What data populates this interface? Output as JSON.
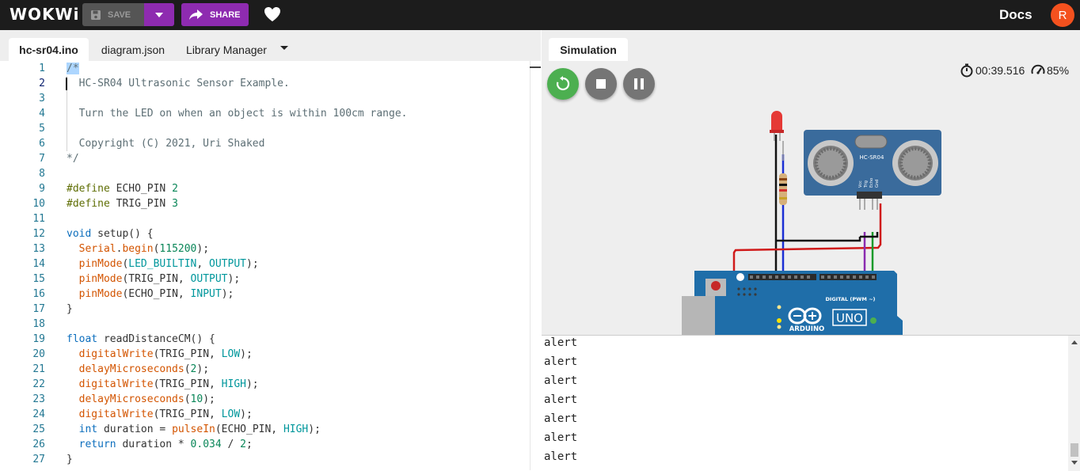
{
  "topbar": {
    "logo": "WOKWi",
    "save_label": "SAVE",
    "share_label": "SHARE",
    "docs_label": "Docs",
    "avatar_initial": "R",
    "accent": "#8e2bb0"
  },
  "editor": {
    "tabs": [
      {
        "label": "hc-sr04.ino",
        "active": true
      },
      {
        "label": "diagram.json",
        "active": false
      },
      {
        "label": "Library Manager",
        "active": false
      }
    ]
  },
  "code_lines": [
    {
      "n": "1",
      "segs": [
        {
          "t": "/*",
          "c": "c-com sel"
        }
      ]
    },
    {
      "n": "2",
      "segs": [
        {
          "t": "  HC-SR04 Ultrasonic Sensor Example.",
          "c": "c-com"
        }
      ]
    },
    {
      "n": "3",
      "segs": [
        {
          "t": "",
          "c": ""
        }
      ]
    },
    {
      "n": "4",
      "segs": [
        {
          "t": "  Turn the LED on when an object is within 100cm range.",
          "c": "c-com"
        }
      ]
    },
    {
      "n": "5",
      "segs": [
        {
          "t": "",
          "c": ""
        }
      ]
    },
    {
      "n": "6",
      "segs": [
        {
          "t": "  Copyright (C) 2021, Uri Shaked",
          "c": "c-com"
        }
      ]
    },
    {
      "n": "7",
      "segs": [
        {
          "t": "*/",
          "c": "c-com"
        }
      ]
    },
    {
      "n": "8",
      "segs": [
        {
          "t": "",
          "c": ""
        }
      ]
    },
    {
      "n": "9",
      "segs": [
        {
          "t": "#define",
          "c": "c-def"
        },
        {
          "t": " ECHO_PIN ",
          "c": ""
        },
        {
          "t": "2",
          "c": "c-num"
        }
      ]
    },
    {
      "n": "10",
      "segs": [
        {
          "t": "#define",
          "c": "c-def"
        },
        {
          "t": " TRIG_PIN ",
          "c": ""
        },
        {
          "t": "3",
          "c": "c-num"
        }
      ]
    },
    {
      "n": "11",
      "segs": [
        {
          "t": "",
          "c": ""
        }
      ]
    },
    {
      "n": "12",
      "segs": [
        {
          "t": "void",
          "c": "c-kw"
        },
        {
          "t": " setup() {",
          "c": ""
        }
      ]
    },
    {
      "n": "13",
      "segs": [
        {
          "t": "  ",
          "c": ""
        },
        {
          "t": "Serial",
          "c": "c-fn"
        },
        {
          "t": ".",
          "c": ""
        },
        {
          "t": "begin",
          "c": "c-fn"
        },
        {
          "t": "(",
          "c": ""
        },
        {
          "t": "115200",
          "c": "c-num"
        },
        {
          "t": ");",
          "c": ""
        }
      ]
    },
    {
      "n": "14",
      "segs": [
        {
          "t": "  ",
          "c": ""
        },
        {
          "t": "pinMode",
          "c": "c-fn"
        },
        {
          "t": "(",
          "c": ""
        },
        {
          "t": "LED_BUILTIN",
          "c": "c-cn"
        },
        {
          "t": ", ",
          "c": ""
        },
        {
          "t": "OUTPUT",
          "c": "c-cn"
        },
        {
          "t": ");",
          "c": ""
        }
      ]
    },
    {
      "n": "15",
      "segs": [
        {
          "t": "  ",
          "c": ""
        },
        {
          "t": "pinMode",
          "c": "c-fn"
        },
        {
          "t": "(TRIG_PIN, ",
          "c": ""
        },
        {
          "t": "OUTPUT",
          "c": "c-cn"
        },
        {
          "t": ");",
          "c": ""
        }
      ]
    },
    {
      "n": "16",
      "segs": [
        {
          "t": "  ",
          "c": ""
        },
        {
          "t": "pinMode",
          "c": "c-fn"
        },
        {
          "t": "(ECHO_PIN, ",
          "c": ""
        },
        {
          "t": "INPUT",
          "c": "c-cn"
        },
        {
          "t": ");",
          "c": ""
        }
      ]
    },
    {
      "n": "17",
      "segs": [
        {
          "t": "}",
          "c": ""
        }
      ]
    },
    {
      "n": "18",
      "segs": [
        {
          "t": "",
          "c": ""
        }
      ]
    },
    {
      "n": "19",
      "segs": [
        {
          "t": "float",
          "c": "c-kw"
        },
        {
          "t": " readDistanceCM() {",
          "c": ""
        }
      ]
    },
    {
      "n": "20",
      "segs": [
        {
          "t": "  ",
          "c": ""
        },
        {
          "t": "digitalWrite",
          "c": "c-fn"
        },
        {
          "t": "(TRIG_PIN, ",
          "c": ""
        },
        {
          "t": "LOW",
          "c": "c-cn"
        },
        {
          "t": ");",
          "c": ""
        }
      ]
    },
    {
      "n": "21",
      "segs": [
        {
          "t": "  ",
          "c": ""
        },
        {
          "t": "delayMicroseconds",
          "c": "c-fn"
        },
        {
          "t": "(",
          "c": ""
        },
        {
          "t": "2",
          "c": "c-num"
        },
        {
          "t": ");",
          "c": ""
        }
      ]
    },
    {
      "n": "22",
      "segs": [
        {
          "t": "  ",
          "c": ""
        },
        {
          "t": "digitalWrite",
          "c": "c-fn"
        },
        {
          "t": "(TRIG_PIN, ",
          "c": ""
        },
        {
          "t": "HIGH",
          "c": "c-cn"
        },
        {
          "t": ");",
          "c": ""
        }
      ]
    },
    {
      "n": "23",
      "segs": [
        {
          "t": "  ",
          "c": ""
        },
        {
          "t": "delayMicroseconds",
          "c": "c-fn"
        },
        {
          "t": "(",
          "c": ""
        },
        {
          "t": "10",
          "c": "c-num"
        },
        {
          "t": ");",
          "c": ""
        }
      ]
    },
    {
      "n": "24",
      "segs": [
        {
          "t": "  ",
          "c": ""
        },
        {
          "t": "digitalWrite",
          "c": "c-fn"
        },
        {
          "t": "(TRIG_PIN, ",
          "c": ""
        },
        {
          "t": "LOW",
          "c": "c-cn"
        },
        {
          "t": ");",
          "c": ""
        }
      ]
    },
    {
      "n": "25",
      "segs": [
        {
          "t": "  ",
          "c": ""
        },
        {
          "t": "int",
          "c": "c-kw"
        },
        {
          "t": " duration = ",
          "c": ""
        },
        {
          "t": "pulseIn",
          "c": "c-fn"
        },
        {
          "t": "(ECHO_PIN, ",
          "c": ""
        },
        {
          "t": "HIGH",
          "c": "c-cn"
        },
        {
          "t": ");",
          "c": ""
        }
      ]
    },
    {
      "n": "26",
      "segs": [
        {
          "t": "  ",
          "c": ""
        },
        {
          "t": "return",
          "c": "c-kw"
        },
        {
          "t": " duration * ",
          "c": ""
        },
        {
          "t": "0.034",
          "c": "c-num"
        },
        {
          "t": " / ",
          "c": ""
        },
        {
          "t": "2",
          "c": "c-num"
        },
        {
          "t": ";",
          "c": ""
        }
      ]
    },
    {
      "n": "27",
      "segs": [
        {
          "t": "}",
          "c": ""
        }
      ]
    }
  ],
  "simulation": {
    "tab_label": "Simulation",
    "elapsed": "00:39.516",
    "speed": "85%",
    "sensor_label": "HC-SR04",
    "board_brand": "ARDUINO",
    "board_model": "UNO",
    "board_header_label": "DIGITAL (PWM ~)",
    "sensor_pin_labels": [
      "Vcc",
      "Trig",
      "Echo",
      "Gnd"
    ]
  },
  "serial": {
    "lines": [
      "alert",
      "alert",
      "alert",
      "alert",
      "alert",
      "alert",
      "alert"
    ]
  }
}
